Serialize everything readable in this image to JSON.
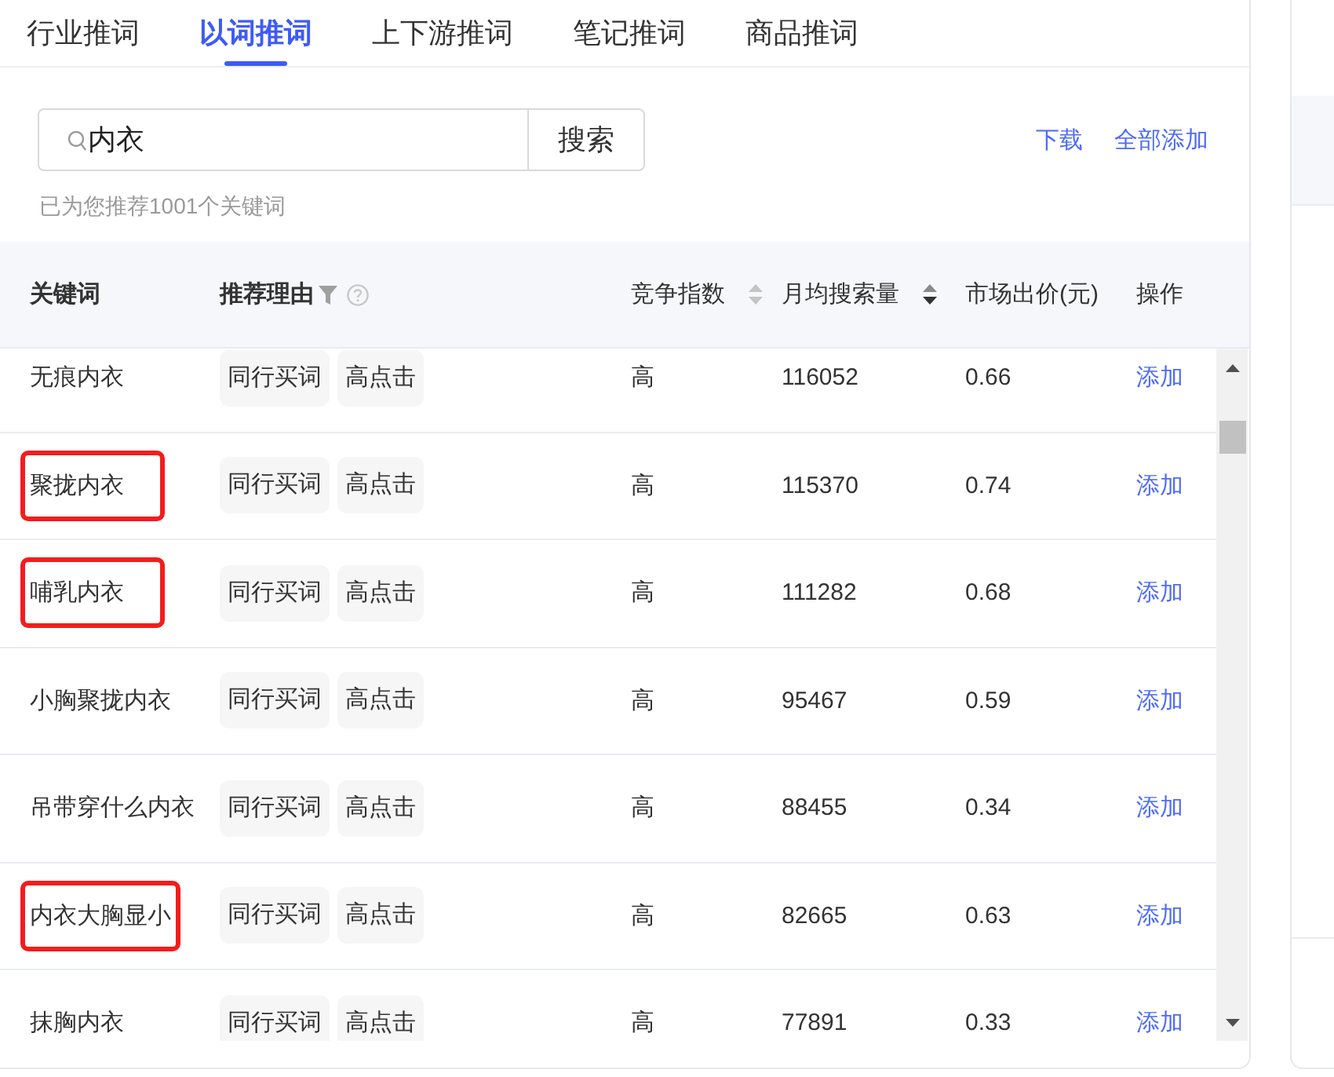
{
  "tabs": [
    {
      "label": "行业推词",
      "selected": false
    },
    {
      "label": "以词推词",
      "selected": true
    },
    {
      "label": "上下游推词",
      "selected": false
    },
    {
      "label": "笔记推词",
      "selected": false
    },
    {
      "label": "商品推词",
      "selected": false
    }
  ],
  "search": {
    "value": "内衣",
    "button": "搜索"
  },
  "actions": [
    "下载",
    "全部添加"
  ],
  "hint": "已为您推荐1001个关键词",
  "table": {
    "columns": [
      {
        "label": "关键词"
      },
      {
        "label": "推荐理由",
        "filter": true,
        "help": true
      },
      {
        "label": "竞争指数",
        "sortable": true,
        "sorted_descending": false
      },
      {
        "label": "月均搜索量",
        "sortable": true,
        "sorted_descending": true
      },
      {
        "label": "市场出价(元)"
      },
      {
        "label": "操作"
      }
    ],
    "rows": [
      {
        "keyword": "无痕内衣",
        "highlighted": false,
        "reasons": [
          "同行买词",
          "高点击"
        ],
        "competition": "高",
        "monthly_searches": "116052",
        "price": "0.66",
        "action": "添加"
      },
      {
        "keyword": "聚拢内衣",
        "highlighted": true,
        "reasons": [
          "同行买词",
          "高点击"
        ],
        "competition": "高",
        "monthly_searches": "115370",
        "price": "0.74",
        "action": "添加"
      },
      {
        "keyword": "哺乳内衣",
        "highlighted": true,
        "reasons": [
          "同行买词",
          "高点击"
        ],
        "competition": "高",
        "monthly_searches": "111282",
        "price": "0.68",
        "action": "添加"
      },
      {
        "keyword": "小胸聚拢内衣",
        "highlighted": false,
        "reasons": [
          "同行买词",
          "高点击"
        ],
        "competition": "高",
        "monthly_searches": "95467",
        "price": "0.59",
        "action": "添加"
      },
      {
        "keyword": "吊带穿什么内衣",
        "highlighted": false,
        "reasons": [
          "同行买词",
          "高点击"
        ],
        "competition": "高",
        "monthly_searches": "88455",
        "price": "0.34",
        "action": "添加"
      },
      {
        "keyword": "内衣大胸显小",
        "highlighted": true,
        "reasons": [
          "同行买词",
          "高点击"
        ],
        "competition": "高",
        "monthly_searches": "82665",
        "price": "0.63",
        "action": "添加"
      },
      {
        "keyword": "抹胸内衣",
        "highlighted": false,
        "reasons": [
          "同行买词",
          "高点击"
        ],
        "competition": "高",
        "monthly_searches": "77891",
        "price": "0.33",
        "action": "添加"
      }
    ]
  }
}
